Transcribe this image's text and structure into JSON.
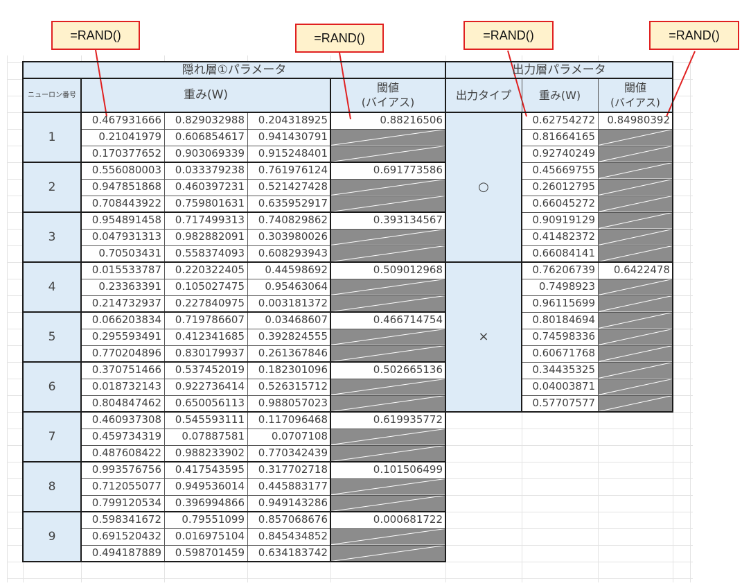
{
  "callouts": [
    "=RAND()",
    "=RAND()",
    "=RAND()",
    "=RAND()"
  ],
  "hidden_header": "隠れ層①パラメータ",
  "output_header": "出力層パラメータ",
  "neuron_label": "ニューロン番号",
  "weight_label": "重み(W)",
  "bias_label_1": "閾値",
  "bias_label_2": "(バイアス)",
  "output_type_label": "出力タイプ",
  "out_weight_label": "重み(W)",
  "out_bias_label_1": "閾値",
  "out_bias_label_2": "(バイアス)",
  "neurons": [
    {
      "id": "1",
      "weights": [
        [
          "0.467931666",
          "0.829032988",
          "0.204318925"
        ],
        [
          "0.21041979",
          "0.606854617",
          "0.941430791"
        ],
        [
          "0.170377652",
          "0.903069339",
          "0.915248401"
        ]
      ],
      "bias": "0.88216506"
    },
    {
      "id": "2",
      "weights": [
        [
          "0.556080003",
          "0.033379238",
          "0.761976124"
        ],
        [
          "0.947851868",
          "0.460397231",
          "0.521427428"
        ],
        [
          "0.708443922",
          "0.759801631",
          "0.635952917"
        ]
      ],
      "bias": "0.691773586"
    },
    {
      "id": "3",
      "weights": [
        [
          "0.954891458",
          "0.717499313",
          "0.740829862"
        ],
        [
          "0.047931313",
          "0.982882091",
          "0.303980026"
        ],
        [
          "0.70503431",
          "0.558374093",
          "0.608293943"
        ]
      ],
      "bias": "0.393134567"
    },
    {
      "id": "4",
      "weights": [
        [
          "0.015533787",
          "0.220322405",
          "0.44598692"
        ],
        [
          "0.23363391",
          "0.105027475",
          "0.95463064"
        ],
        [
          "0.214732937",
          "0.227840975",
          "0.003181372"
        ]
      ],
      "bias": "0.509012968"
    },
    {
      "id": "5",
      "weights": [
        [
          "0.066203834",
          "0.719786607",
          "0.03468607"
        ],
        [
          "0.295593491",
          "0.412341685",
          "0.392824555"
        ],
        [
          "0.770204896",
          "0.830179937",
          "0.261367846"
        ]
      ],
      "bias": "0.466714754"
    },
    {
      "id": "6",
      "weights": [
        [
          "0.370751466",
          "0.537452019",
          "0.182301096"
        ],
        [
          "0.018732143",
          "0.922736414",
          "0.526315712"
        ],
        [
          "0.804847462",
          "0.650056113",
          "0.988057023"
        ]
      ],
      "bias": "0.502665136"
    },
    {
      "id": "7",
      "weights": [
        [
          "0.460937308",
          "0.545593111",
          "0.117096468"
        ],
        [
          "0.459734319",
          "0.07887581",
          "0.0707108"
        ],
        [
          "0.487608422",
          "0.988233902",
          "0.770342439"
        ]
      ],
      "bias": "0.619935772"
    },
    {
      "id": "8",
      "weights": [
        [
          "0.993576756",
          "0.417543595",
          "0.317702718"
        ],
        [
          "0.712055077",
          "0.949536014",
          "0.445883177"
        ],
        [
          "0.799120534",
          "0.396994866",
          "0.949143286"
        ]
      ],
      "bias": "0.101506499"
    },
    {
      "id": "9",
      "weights": [
        [
          "0.598341672",
          "0.79551099",
          "0.857068676"
        ],
        [
          "0.691520432",
          "0.016975104",
          "0.845434852"
        ],
        [
          "0.494187889",
          "0.598701459",
          "0.634183742"
        ]
      ],
      "bias": "0.000681722"
    }
  ],
  "outputs": [
    {
      "type": "○",
      "weights": [
        "0.62754272",
        "0.81664165",
        "0.92740249",
        "0.45669755",
        "0.26012795",
        "0.66045272",
        "0.90919129",
        "0.41482372",
        "0.66084141"
      ],
      "bias": "0.84980392"
    },
    {
      "type": "×",
      "weights": [
        "0.76206739",
        "0.7498923",
        "0.96115699",
        "0.80184694",
        "0.74598336",
        "0.60671768",
        "0.34435325",
        "0.04003871",
        "0.57707577"
      ],
      "bias": "0.6422478"
    }
  ]
}
